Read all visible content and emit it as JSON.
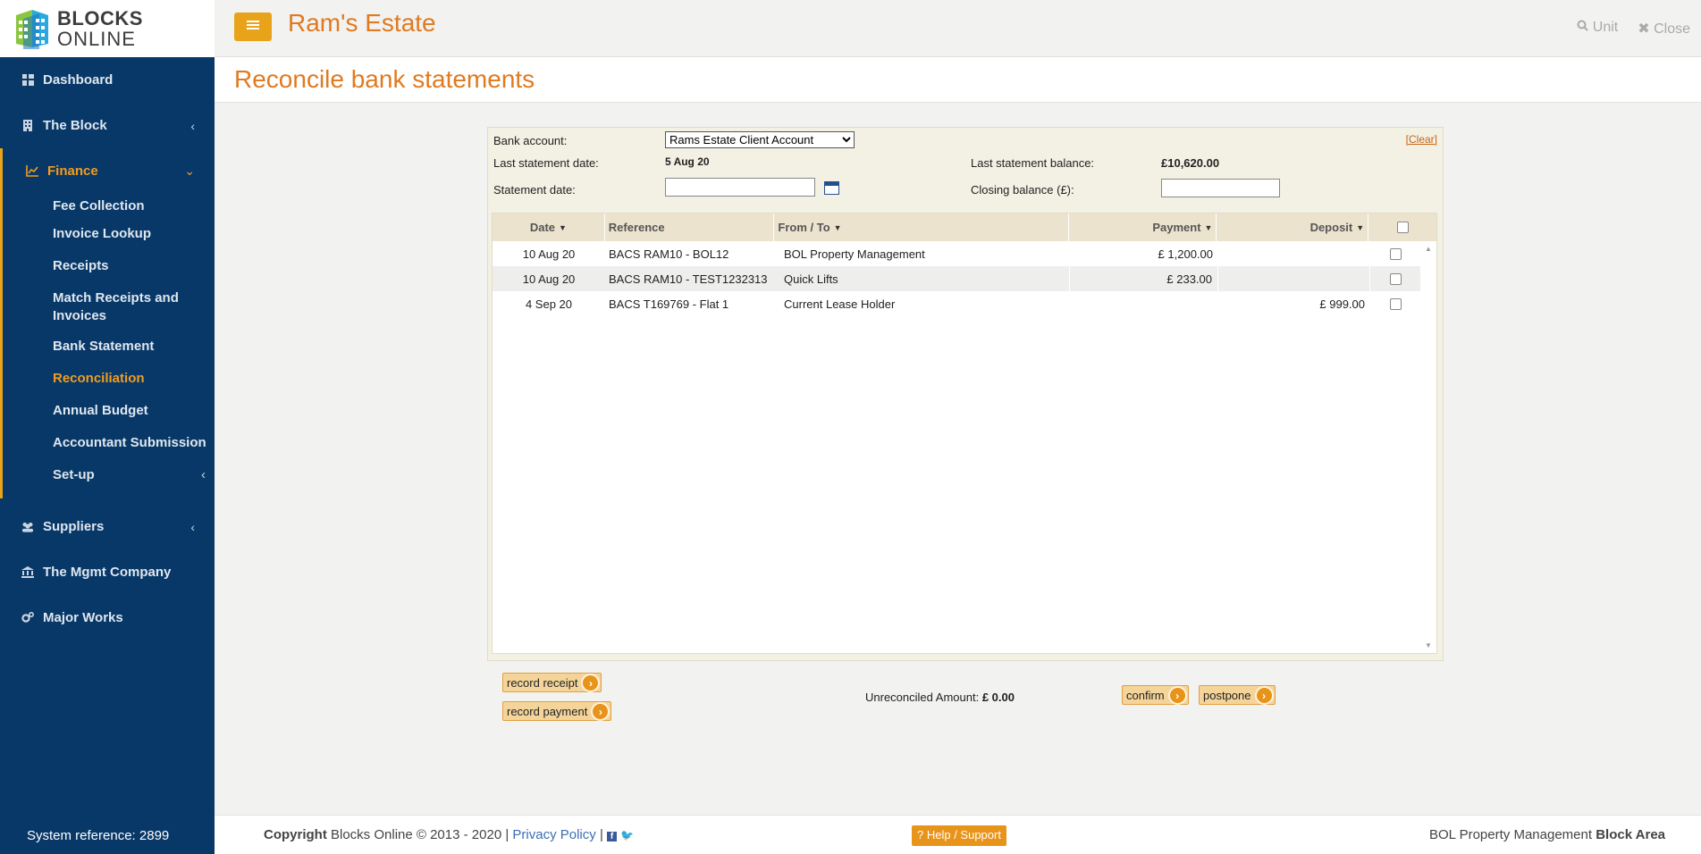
{
  "brand": {
    "line1": "BLOCKS",
    "line2": "ONLINE"
  },
  "sidebar": {
    "items": [
      {
        "label": "Dashboard",
        "icon": "dashboard-icon"
      },
      {
        "label": "The Block",
        "icon": "building-icon"
      }
    ],
    "finance": {
      "label": "Finance",
      "icon": "chart-line-icon",
      "subitems": [
        {
          "label": "Fee Collection"
        },
        {
          "label": "Invoice Lookup"
        },
        {
          "label": "Receipts"
        },
        {
          "label": "Match Receipts and Invoices"
        },
        {
          "label": "Bank Statement"
        },
        {
          "label": "Reconciliation"
        },
        {
          "label": "Annual Budget"
        },
        {
          "label": "Accountant Submission"
        },
        {
          "label": "Set-up"
        }
      ]
    },
    "items_after": [
      {
        "label": "Suppliers",
        "icon": "users-icon"
      },
      {
        "label": "The Mgmt Company",
        "icon": "bank-icon"
      },
      {
        "label": "Major Works",
        "icon": "cogs-icon"
      }
    ],
    "system_reference": "System reference: 2899"
  },
  "header": {
    "estate_name": "Ram's Estate",
    "unit_label": "Unit",
    "close_label": "Close"
  },
  "page": {
    "title": "Reconcile bank statements"
  },
  "form": {
    "bank_account_label": "Bank account:",
    "bank_account_value": "Rams Estate Client Account",
    "clear_label": "[Clear]",
    "last_statement_date_label": "Last statement date:",
    "last_statement_date_value": "5 Aug 20",
    "last_statement_balance_label": "Last statement balance:",
    "last_statement_balance_value": "£10,620.00",
    "statement_date_label": "Statement date:",
    "closing_balance_label": "Closing balance (£):"
  },
  "table": {
    "columns": {
      "date": "Date",
      "reference": "Reference",
      "from_to": "From / To",
      "payment": "Payment",
      "deposit": "Deposit"
    },
    "rows": [
      {
        "date": "10 Aug 20",
        "reference": "BACS RAM10 - BOL12",
        "from_to": "BOL Property Management",
        "payment": "£ 1,200.00",
        "deposit": ""
      },
      {
        "date": "10 Aug 20",
        "reference": "BACS RAM10 - TEST1232313",
        "from_to": "Quick Lifts",
        "payment": "£ 233.00",
        "deposit": ""
      },
      {
        "date": "4 Sep 20",
        "reference": "BACS T169769 - Flat 1",
        "from_to": "Current Lease Holder",
        "payment": "",
        "deposit": "£ 999.00"
      }
    ]
  },
  "actions": {
    "record_receipt": "record receipt",
    "record_payment": "record payment",
    "unreconciled_label": "Unreconciled Amount:",
    "unreconciled_value": "£ 0.00",
    "confirm": "confirm",
    "postpone": "postpone"
  },
  "footer": {
    "copyright_bold": "Copyright",
    "copyright_text": "Blocks Online © 2013 - 2020 |",
    "privacy": "Privacy Policy",
    "sep": "|",
    "help": "Help / Support",
    "company": "BOL Property Management",
    "area": "Block Area"
  },
  "colors": {
    "sidebar": "#083868",
    "accent": "#e8a31a",
    "title": "#e07a1f"
  }
}
